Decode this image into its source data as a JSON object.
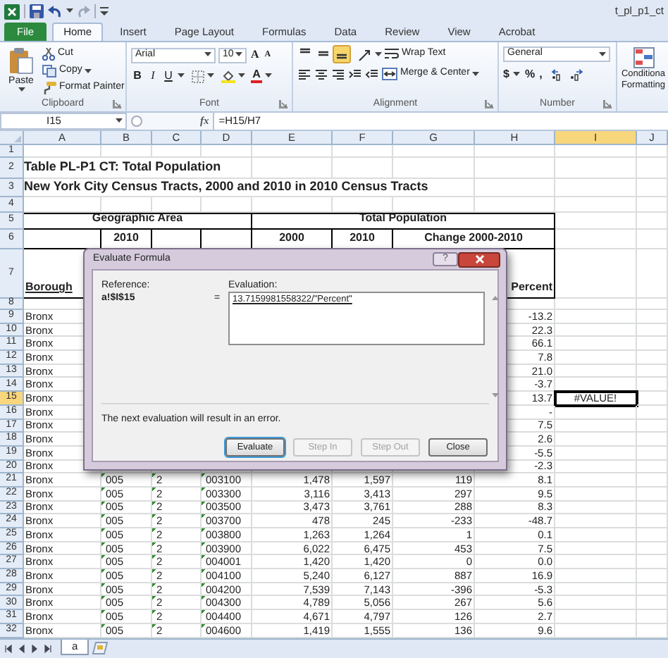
{
  "title_bar": {
    "title": "t_pl_p1_ct"
  },
  "ribbon_tabs": [
    {
      "label": "File",
      "kind": "file"
    },
    {
      "label": "Home",
      "kind": "tab",
      "selected": true
    },
    {
      "label": "Insert",
      "kind": "tab",
      "selected": false
    },
    {
      "label": "Page Layout",
      "kind": "tab",
      "selected": false
    },
    {
      "label": "Formulas",
      "kind": "tab",
      "selected": false
    },
    {
      "label": "Data",
      "kind": "tab",
      "selected": false
    },
    {
      "label": "Review",
      "kind": "tab",
      "selected": false
    },
    {
      "label": "View",
      "kind": "tab",
      "selected": false
    },
    {
      "label": "Acrobat",
      "kind": "tab",
      "selected": false
    }
  ],
  "clipboard": {
    "paste": "Paste",
    "cut": "Cut",
    "copy": "Copy",
    "format_painter": "Format Painter",
    "label": "Clipboard"
  },
  "font": {
    "name": "Arial",
    "size": "10",
    "grow": "A",
    "shrink": "A",
    "style_buttons": [
      "B",
      "I",
      "U"
    ],
    "font_color_letter": "A",
    "label": "Font"
  },
  "alignment": {
    "vertical": [
      {
        "selected": false
      },
      {
        "selected": false
      },
      {
        "selected": true
      }
    ],
    "wrap_text": "Wrap Text",
    "merge": "Merge & Center",
    "label": "Alignment"
  },
  "number": {
    "format": "General",
    "buttons": [
      "$",
      "%",
      ","
    ],
    "label": "Number"
  },
  "conditional_formatting": [
    "Conditiona",
    "Formatting"
  ],
  "formula_bar": {
    "name_box": "I15",
    "function_label": "fx",
    "formula": "=H15/H7"
  },
  "sheet": {
    "columns": [
      {
        "label": "A",
        "selected": false
      },
      {
        "label": "B",
        "selected": false
      },
      {
        "label": "C",
        "selected": false
      },
      {
        "label": "D",
        "selected": false
      },
      {
        "label": "E",
        "selected": false
      },
      {
        "label": "F",
        "selected": false
      },
      {
        "label": "G",
        "selected": false
      },
      {
        "label": "H",
        "selected": false
      },
      {
        "label": "I",
        "selected": true
      },
      {
        "label": "J",
        "selected": false
      }
    ],
    "rows": [
      {
        "label": "1",
        "kind": "blank",
        "selected": false
      },
      {
        "label": "2",
        "kind": "title",
        "selected": false,
        "cells": {
          "A": "Table PL-P1 CT:  Total Population"
        }
      },
      {
        "label": "3",
        "kind": "title",
        "selected": false,
        "cells": {
          "A": "New York City Census Tracts, 2000 and 2010 in 2010 Census Tracts"
        }
      },
      {
        "label": "4",
        "kind": "blank",
        "selected": false
      },
      {
        "label": "5",
        "kind": "header",
        "selected": false,
        "cells": {
          "A": "Geographic Area",
          "E": "Total Population"
        }
      },
      {
        "label": "6",
        "kind": "header",
        "selected": false,
        "cells": {
          "B": "2010",
          "E": "2000",
          "F": "2010",
          "G": "Change 2000-2010"
        }
      },
      {
        "label": "7",
        "kind": "header",
        "selected": false,
        "cells": {
          "A": "Borough",
          "H": "Percent"
        }
      },
      {
        "label": "8",
        "kind": "blank",
        "selected": false
      },
      {
        "label": "9",
        "kind": "data",
        "selected": false,
        "cells": {
          "A": "Bronx",
          "H": "-13.2"
        }
      },
      {
        "label": "10",
        "kind": "data",
        "selected": false,
        "cells": {
          "A": "Bronx",
          "H": "22.3"
        }
      },
      {
        "label": "11",
        "kind": "data",
        "selected": false,
        "cells": {
          "A": "Bronx",
          "H": "66.1"
        }
      },
      {
        "label": "12",
        "kind": "data",
        "selected": false,
        "cells": {
          "A": "Bronx",
          "H": "7.8"
        }
      },
      {
        "label": "13",
        "kind": "data",
        "selected": false,
        "cells": {
          "A": "Bronx",
          "H": "21.0"
        }
      },
      {
        "label": "14",
        "kind": "data",
        "selected": false,
        "cells": {
          "A": "Bronx",
          "H": "-3.7"
        }
      },
      {
        "label": "15",
        "kind": "data",
        "selected": true,
        "cells": {
          "A": "Bronx",
          "H": "13.7",
          "I": "#VALUE!"
        }
      },
      {
        "label": "16",
        "kind": "data",
        "selected": false,
        "cells": {
          "A": "Bronx",
          "H": "-"
        }
      },
      {
        "label": "17",
        "kind": "data",
        "selected": false,
        "cells": {
          "A": "Bronx",
          "H": "7.5"
        }
      },
      {
        "label": "18",
        "kind": "data",
        "selected": false,
        "cells": {
          "A": "Bronx",
          "H": "2.6"
        }
      },
      {
        "label": "19",
        "kind": "data",
        "selected": false,
        "cells": {
          "A": "Bronx",
          "H": "-5.5"
        }
      },
      {
        "label": "20",
        "kind": "data",
        "selected": false,
        "cells": {
          "A": "Bronx",
          "H": "-2.3"
        }
      },
      {
        "label": "21",
        "kind": "data",
        "selected": false,
        "flagged": true,
        "values": [
          "Bronx",
          "005",
          "2",
          "003100",
          "1,478",
          "1,597",
          "119",
          "8.1"
        ]
      },
      {
        "label": "22",
        "kind": "data",
        "selected": false,
        "flagged": true,
        "values": [
          "Bronx",
          "005",
          "2",
          "003300",
          "3,116",
          "3,413",
          "297",
          "9.5"
        ]
      },
      {
        "label": "23",
        "kind": "data",
        "selected": false,
        "flagged": true,
        "values": [
          "Bronx",
          "005",
          "2",
          "003500",
          "3,473",
          "3,761",
          "288",
          "8.3"
        ]
      },
      {
        "label": "24",
        "kind": "data",
        "selected": false,
        "flagged": true,
        "values": [
          "Bronx",
          "005",
          "2",
          "003700",
          "478",
          "245",
          "-233",
          "-48.7"
        ]
      },
      {
        "label": "25",
        "kind": "data",
        "selected": false,
        "flagged": true,
        "values": [
          "Bronx",
          "005",
          "2",
          "003800",
          "1,263",
          "1,264",
          "1",
          "0.1"
        ]
      },
      {
        "label": "26",
        "kind": "data",
        "selected": false,
        "flagged": true,
        "values": [
          "Bronx",
          "005",
          "2",
          "003900",
          "6,022",
          "6,475",
          "453",
          "7.5"
        ]
      },
      {
        "label": "27",
        "kind": "data",
        "selected": false,
        "flagged": true,
        "values": [
          "Bronx",
          "005",
          "2",
          "004001",
          "1,420",
          "1,420",
          "0",
          "0.0"
        ]
      },
      {
        "label": "28",
        "kind": "data",
        "selected": false,
        "flagged": true,
        "values": [
          "Bronx",
          "005",
          "2",
          "004100",
          "5,240",
          "6,127",
          "887",
          "16.9"
        ]
      },
      {
        "label": "29",
        "kind": "data",
        "selected": false,
        "flagged": true,
        "values": [
          "Bronx",
          "005",
          "2",
          "004200",
          "7,539",
          "7,143",
          "-396",
          "-5.3"
        ]
      },
      {
        "label": "30",
        "kind": "data",
        "selected": false,
        "flagged": true,
        "values": [
          "Bronx",
          "005",
          "2",
          "004300",
          "4,789",
          "5,056",
          "267",
          "5.6"
        ]
      },
      {
        "label": "31",
        "kind": "data",
        "selected": false,
        "flagged": true,
        "values": [
          "Bronx",
          "005",
          "2",
          "004400",
          "4,671",
          "4,797",
          "126",
          "2.7"
        ]
      },
      {
        "label": "32",
        "kind": "data",
        "selected": false,
        "flagged": true,
        "values": [
          "Bronx",
          "005",
          "2",
          "004600",
          "1,419",
          "1,555",
          "136",
          "9.6"
        ]
      }
    ]
  },
  "dialog": {
    "title": "Evaluate Formula",
    "help": "?",
    "reference_label": "Reference:",
    "reference": "a!$I$15",
    "equals": "=",
    "evaluation_label": "Evaluation:",
    "evaluation": "13.7159981558322/\"Percent\"",
    "message": "The next evaluation will result in an error.",
    "buttons": [
      {
        "label": "Evaluate",
        "disabled": false,
        "default": true
      },
      {
        "label": "Step In",
        "disabled": true,
        "default": false
      },
      {
        "label": "Step Out",
        "disabled": true,
        "default": false
      },
      {
        "label": "Close",
        "disabled": false,
        "default": false
      }
    ]
  },
  "sheet_tabs": [
    {
      "label": "a",
      "selected": true
    }
  ]
}
